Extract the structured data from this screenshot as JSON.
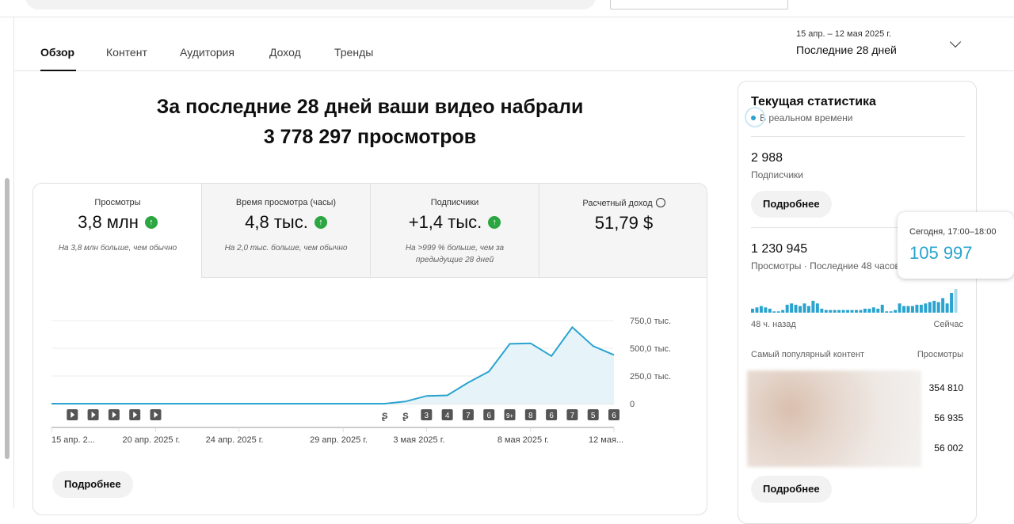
{
  "tabs": [
    "Обзор",
    "Контент",
    "Аудитория",
    "Доход",
    "Тренды"
  ],
  "date_range": {
    "dates": "15 апр. – 12 мая 2025 г.",
    "label": "Последние 28 дней"
  },
  "headline": {
    "line1": "За последние 28 дней ваши видео набрали",
    "line2": "3 778 297 просмотров"
  },
  "metrics": [
    {
      "label": "Просмотры",
      "value": "3,8 млн",
      "note": "На 3,8 млн больше, чем обычно",
      "up": true
    },
    {
      "label": "Время просмотра (часы)",
      "value": "4,8 тыс.",
      "note": "На 2,0 тыс. больше, чем обычно",
      "up": true
    },
    {
      "label": "Подписчики",
      "value": "+1,4 тыс.",
      "note": "На >999 % больше, чем за предыдущие 28 дней",
      "up": true
    },
    {
      "label": "Расчетный доход",
      "value": "51,79 $",
      "note": "",
      "up": false
    }
  ],
  "more_label": "Подробнее",
  "chart_data": {
    "type": "area",
    "series": [
      {
        "name": "Просмотры",
        "values": [
          0,
          0,
          0,
          0,
          0,
          0,
          0,
          0,
          0,
          0,
          0,
          0,
          0,
          0,
          0,
          0,
          0,
          20000,
          70000,
          75000,
          190000,
          290000,
          540000,
          545000,
          430000,
          690000,
          520000,
          440000
        ]
      }
    ],
    "ylim": [
      0,
      750000
    ],
    "yticks": [
      "750,0 тыс.",
      "500,0 тыс.",
      "250,0 тыс.",
      "0"
    ],
    "xticks": [
      {
        "i": 0,
        "label": "15 апр. 2..."
      },
      {
        "i": 5,
        "label": "20 апр. 2025 г."
      },
      {
        "i": 9,
        "label": "24 апр. 2025 г."
      },
      {
        "i": 14,
        "label": "29 апр. 2025 г."
      },
      {
        "i": 18,
        "label": "3 мая 2025 г."
      },
      {
        "i": 23,
        "label": "8 мая 2025 г."
      },
      {
        "i": 27,
        "label": "12 мая..."
      }
    ],
    "markers": [
      {
        "i": 1,
        "t": "play"
      },
      {
        "i": 2,
        "t": "play"
      },
      {
        "i": 3,
        "t": "play"
      },
      {
        "i": 4,
        "t": "play"
      },
      {
        "i": 5,
        "t": "play"
      },
      {
        "i": 16,
        "t": "shorts"
      },
      {
        "i": 17,
        "t": "shorts"
      },
      {
        "i": 18,
        "t": "3"
      },
      {
        "i": 19,
        "t": "4"
      },
      {
        "i": 20,
        "t": "7"
      },
      {
        "i": 21,
        "t": "6"
      },
      {
        "i": 22,
        "t": "9+"
      },
      {
        "i": 23,
        "t": "8"
      },
      {
        "i": 24,
        "t": "6"
      },
      {
        "i": 25,
        "t": "7"
      },
      {
        "i": 26,
        "t": "5"
      },
      {
        "i": 27,
        "t": "6"
      }
    ],
    "color": "#2aa3cf"
  },
  "realtime": {
    "title": "Текущая статистика",
    "live": "В реальном времени",
    "subs": "2 988",
    "subs_label": "Подписчики",
    "views": "1 230 945",
    "views_label": "Просмотры · Последние 48 часов",
    "bars": [
      3,
      4,
      5,
      4,
      3,
      1,
      1,
      2,
      6,
      7,
      6,
      5,
      7,
      5,
      9,
      7,
      3,
      2,
      2,
      2,
      2,
      2,
      2,
      2,
      2,
      2,
      3,
      3,
      4,
      3,
      6,
      1,
      1,
      2,
      7,
      5,
      5,
      5,
      6,
      6,
      7,
      8,
      9,
      8,
      11,
      7,
      15,
      18
    ],
    "from": "48 ч. назад",
    "to": "Сейчас",
    "top_label": "Самый популярный контент",
    "top_views_label": "Просмотры",
    "top_values": [
      "354 810",
      "56 935",
      "56 002"
    ]
  },
  "tooltip": {
    "time": "Сегодня, 17:00–18:00",
    "value": "105 997"
  }
}
